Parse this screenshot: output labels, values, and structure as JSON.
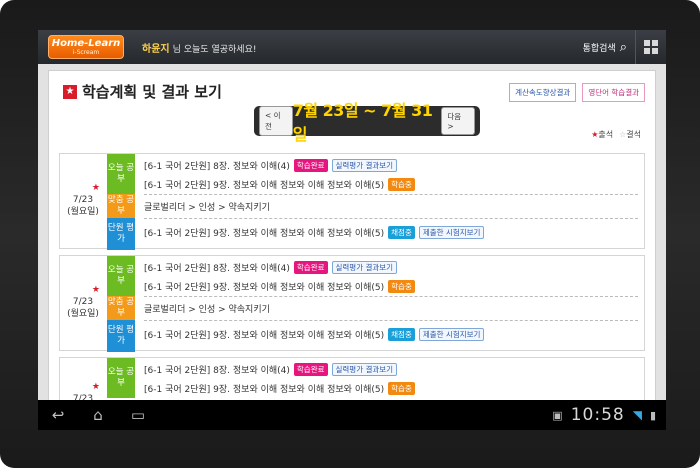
{
  "header": {
    "logo_main": "Home-Learn",
    "logo_sub": "i-Scream",
    "user_name": "하윤지",
    "greeting": "님 오늘도 열공하세요!",
    "search_label": "통합검색"
  },
  "page": {
    "title": "학습계획 및 결과 보기",
    "link1": "계산속도향상결과",
    "link2": "영단어 학습결과",
    "prev": "< 이전",
    "next": "다음 >",
    "date_range": "7월 23일 ~ 7월 31일",
    "legend_on": "출석",
    "legend_off": "결석"
  },
  "days": [
    {
      "date": "7/23",
      "weekday": "(월요일)",
      "cat1": "오늘 공부",
      "cat2": "맞춤 공부",
      "cat3": "단원 평가",
      "row1": "[6-1 국어 2단원] 8장. 정보와 이해(4)",
      "row1_badge": "학습완료",
      "row1_link": "실력평가 결과보기",
      "row2": "[6-1 국어 2단원] 9장. 정보와 이해 정보와 이해 정보와 이해(5)",
      "row2_badge": "학습중",
      "row3": "글로벌리더 > 인성 > 약속지키기",
      "row4": "[6-1 국어 2단원] 9장. 정보와 이해 정보와 이해 정보와 이해(5)",
      "row4_badge": "채점중",
      "row4_link": "제출한 시험지보기"
    },
    {
      "date": "7/23",
      "weekday": "(월요일)",
      "cat1": "오늘 공부",
      "cat2": "맞춤 공부",
      "cat3": "단원 평가",
      "row1": "[6-1 국어 2단원] 8장. 정보와 이해(4)",
      "row1_badge": "학습완료",
      "row1_link": "실력평가 결과보기",
      "row2": "[6-1 국어 2단원] 9장. 정보와 이해 정보와 이해 정보와 이해(5)",
      "row2_badge": "학습중",
      "row3": "글로벌리더 > 인성 > 약속지키기",
      "row4": "[6-1 국어 2단원] 9장. 정보와 이해 정보와 이해 정보와 이해(5)",
      "row4_badge": "채점중",
      "row4_link": "제출한 시험지보기"
    },
    {
      "date": "7/23",
      "cat1": "오늘 공부",
      "row1": "[6-1 국어 2단원] 8장. 정보와 이해(4)",
      "row1_badge": "학습완료",
      "row1_link": "실력평가 결과보기",
      "row2": "[6-1 국어 2단원] 9장. 정보와 이해 정보와 이해 정보와 이해(5)",
      "row2_badge": "학습중"
    }
  ],
  "sysbar": {
    "clock": "10:58"
  }
}
